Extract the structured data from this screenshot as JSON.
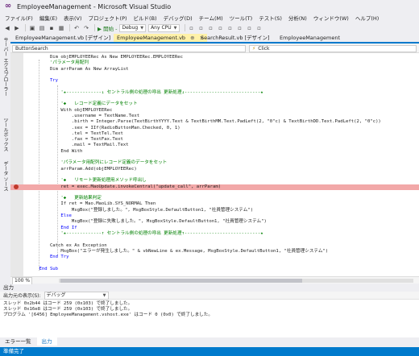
{
  "window": {
    "title": "EmployeeManagement - Microsoft Visual Studio"
  },
  "menu": [
    "ファイル(F)",
    "編集(E)",
    "表示(V)",
    "プロジェクト(P)",
    "ビルド(B)",
    "デバッグ(D)",
    "チーム(M)",
    "ツール(T)",
    "テスト(S)",
    "分析(N)",
    "ウィンドウ(W)",
    "ヘルプ(H)"
  ],
  "toolbar": {
    "start_label": "▶ 開始 -",
    "config": "Debug",
    "platform": "Any CPU"
  },
  "left_strip": [
    "サーバー エクスプローラー",
    "ツールボックス",
    "データ ソース"
  ],
  "tabs": [
    {
      "label": "EmployeeManagement.vb [デザイン]"
    },
    {
      "label": "EmployeeManagement.vb",
      "active": true
    },
    {
      "label": "SearchResult.vb [デザイン]"
    },
    {
      "label": "EmployeeManagement"
    }
  ],
  "navbar": {
    "left": "ButtonSearch",
    "right": "Click"
  },
  "code": [
    {
      "text": "        Dim objEMPLOYEERec As New EMPLOYEERec.EMPLOYEERec",
      "kind": "code"
    },
    {
      "text": "        'パラメータ用配列",
      "kind": "comment"
    },
    {
      "text": "        Dim arrParam As New ArrayList",
      "kind": "code"
    },
    {
      "text": "",
      "kind": "code"
    },
    {
      "text": "        Try",
      "kind": "keyword"
    },
    {
      "text": "",
      "kind": "code"
    },
    {
      "text": "            '★-------------↓ セントラル側の処理の呼出 更新処理↓----------------------------★",
      "kind": "comment"
    },
    {
      "text": "",
      "kind": "code"
    },
    {
      "text": "            '◆   レコード定義にデータをセット",
      "kind": "comment"
    },
    {
      "text": "            With objEMPLOYEERec",
      "kind": "code"
    },
    {
      "text": "                .username = TextName.Text",
      "kind": "code"
    },
    {
      "text": "                .birth = Integer.Parse(TextBirthYYYY.Text & TextBirthMM.Text.PadLeft(2, \"0\"c) & TextBirthDD.Text.PadLeft(2, \"0\"c))",
      "kind": "code"
    },
    {
      "text": "                .sex = IIf(RadioButtonMan.Checked, 0, 1)",
      "kind": "code"
    },
    {
      "text": "                .tel = TextTel.Text",
      "kind": "code"
    },
    {
      "text": "                .fax = TextFax.Text",
      "kind": "code"
    },
    {
      "text": "                .mail = TextMail.Text",
      "kind": "code"
    },
    {
      "text": "            End With",
      "kind": "code"
    },
    {
      "text": "",
      "kind": "code"
    },
    {
      "text": "            'パラメータ用配列にレコード定義のデータをセット",
      "kind": "comment"
    },
    {
      "text": "            arrParam.Add(objEMPLOYEERec)",
      "kind": "code"
    },
    {
      "text": "",
      "kind": "code"
    },
    {
      "text": "            '◆   リモート更新処理用メソッド呼出し",
      "kind": "comment"
    },
    {
      "text": "            ret = exec.MaoUpdate.invokeCentral(\"update_call\", arrParam)",
      "kind": "breakpoint"
    },
    {
      "text": "",
      "kind": "code"
    },
    {
      "text": "            '◆   更新結果判定",
      "kind": "comment"
    },
    {
      "text": "            If ret = Mao.MaoLib.SYS_NORMAL Then",
      "kind": "code"
    },
    {
      "text": "                MsgBox(\"登録しました。\", MsgBoxStyle.DefaultButton1, \"社員管理システム\")",
      "kind": "code"
    },
    {
      "text": "            Else",
      "kind": "keyword"
    },
    {
      "text": "                MsgBox(\"登録に失敗しました。\", MsgBoxStyle.DefaultButton1, \"社員管理システム\")",
      "kind": "code"
    },
    {
      "text": "            End If",
      "kind": "keyword"
    },
    {
      "text": "            '★-------------↑ セントラル側の処理の呼出 更新処理↑----------------------------★",
      "kind": "comment"
    },
    {
      "text": "",
      "kind": "code"
    },
    {
      "text": "        Catch ex As Exception",
      "kind": "code"
    },
    {
      "text": "            MsgBox(\"エラーが発生しました。\" & vbNewLine & ex.Message, MsgBoxStyle.DefaultButton1, \"社員管理システム\")",
      "kind": "code"
    },
    {
      "text": "        End Try",
      "kind": "keyword"
    },
    {
      "text": "",
      "kind": "code"
    },
    {
      "text": "    End Sub",
      "kind": "keyword"
    }
  ],
  "editor_zoom": "100 %",
  "output": {
    "title": "出力",
    "source_label": "出力元の表示(S):",
    "source_value": "デバッグ",
    "lines": [
      "スレッド 0x2b44 はコード 259 (0x103) で終了しました。",
      "スレッド 0x16e8 はコード 259 (0x103) で終了しました。",
      "プログラム '[6456] EmployeeManagement.vshost.exe' はコード 0 (0x0) で終了しました。"
    ]
  },
  "bottom_tabs": [
    {
      "label": "エラー一覧"
    },
    {
      "label": "出力",
      "active": true
    }
  ],
  "status": "準備完了",
  "colors": {
    "accent": "#007acc",
    "active_tab": "#fff1a8",
    "breakpoint": "#c0392b",
    "breakpoint_line": "#f2a8a8",
    "comment": "#008000",
    "keyword": "#0000ff"
  }
}
